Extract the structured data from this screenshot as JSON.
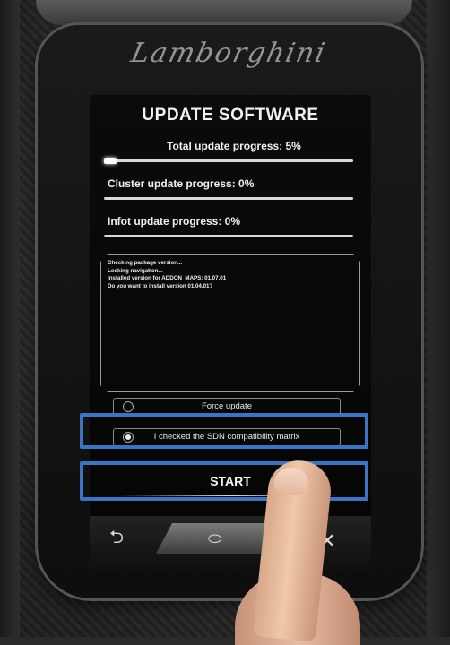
{
  "screen": {
    "title": "UPDATE SOFTWARE",
    "progress": [
      {
        "label": "Total update progress: 5%",
        "value": 0.05
      },
      {
        "label": "Cluster update progress: 0%",
        "value": 0.0
      },
      {
        "label": "Infot update progress: 0%",
        "value": 0.0
      }
    ],
    "log_lines": [
      "Checking package version...",
      "Locking navigation...",
      "Installed version for ADDON_MAPS: 01.07.01",
      "Do you want to install version 01.04.01?"
    ],
    "options": [
      {
        "label": "Force update",
        "selected": false
      },
      {
        "label": "I checked the SDN compatibility matrix",
        "selected": true
      }
    ],
    "start_label": "START"
  },
  "nav": {
    "icons": [
      "back-icon",
      "home-icon",
      "close-icon"
    ]
  },
  "colors": {
    "highlight": "#3b74c4",
    "screen_bg": "#050505",
    "text": "#f2f2f2"
  }
}
